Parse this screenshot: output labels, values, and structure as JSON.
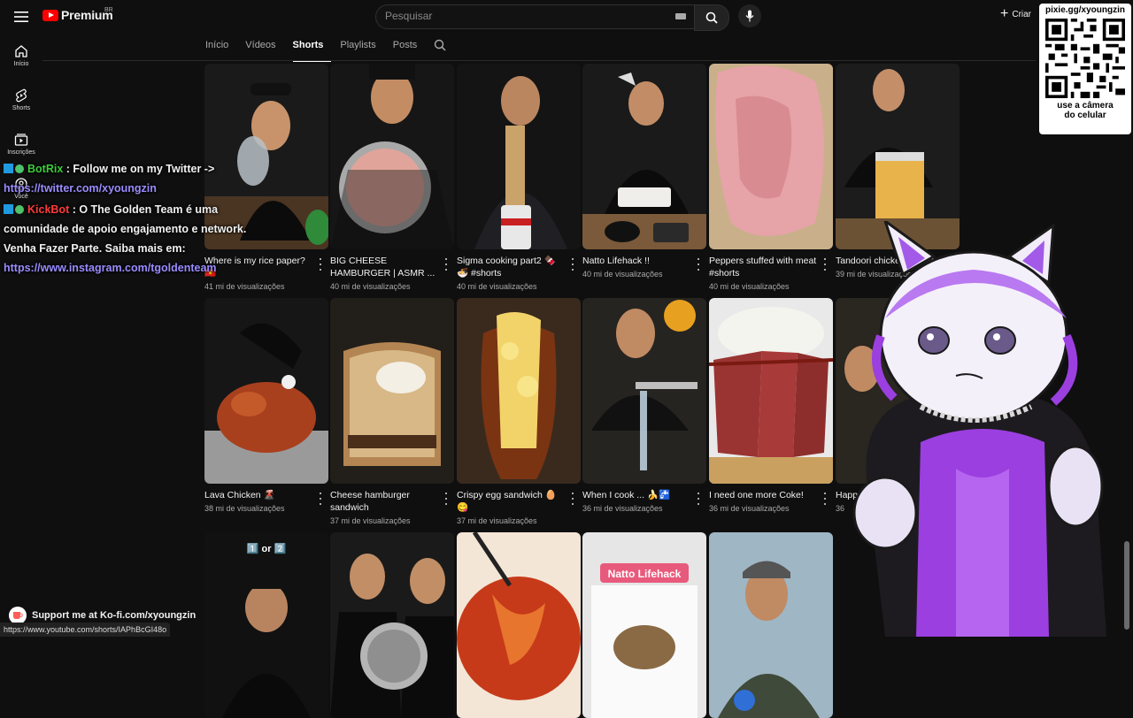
{
  "header": {
    "logo_text": "Premium",
    "logo_country": "BR",
    "search_placeholder": "Pesquisar",
    "create_label": "Criar"
  },
  "qr": {
    "title": "pixie.gg/xyoungzin",
    "caption_line1": "use a câmera",
    "caption_line2": "do celular"
  },
  "sidebar": {
    "items": [
      {
        "label": "Início",
        "icon": "home-icon"
      },
      {
        "label": "Shorts",
        "icon": "shorts-icon"
      },
      {
        "label": "Inscrições",
        "icon": "subscriptions-icon"
      },
      {
        "label": "Você",
        "icon": "you-icon"
      }
    ]
  },
  "tabs": [
    {
      "label": "Início"
    },
    {
      "label": "Vídeos"
    },
    {
      "label": "Shorts",
      "active": true
    },
    {
      "label": "Playlists"
    },
    {
      "label": "Posts"
    }
  ],
  "shorts": [
    {
      "title": "Where is my rice paper? 🇻🇳",
      "views": "41 mi de visualizações"
    },
    {
      "title": "BIG CHEESE HAMBURGER | ASMR ...",
      "views": "40 mi de visualizações"
    },
    {
      "title": "Sigma cooking part2 🍫🍜 #shorts",
      "views": "40 mi de visualizações"
    },
    {
      "title": "Natto Lifehack !!",
      "views": "40 mi de visualizações"
    },
    {
      "title": "Peppers stuffed with meat #shorts",
      "views": "40 mi de visualizações"
    },
    {
      "title": "Tandoori chicken #shorts",
      "views": "39 mi de visualizações"
    },
    {
      "title": "Lava Chicken 🌋",
      "views": "38 mi de visualizações"
    },
    {
      "title": "Cheese hamburger sandwich",
      "views": "37 mi de visualizações"
    },
    {
      "title": "Crispy egg sandwich 🥚😋",
      "views": "37 mi de visualizações"
    },
    {
      "title": "When I cook ... 🍌🚰",
      "views": "36 mi de visualizações"
    },
    {
      "title": "I need one more Coke!",
      "views": "36 mi de visualizações"
    },
    {
      "title": "Happ 😇",
      "views": "36"
    },
    {
      "title": "",
      "views": "",
      "thumb_text": "1️⃣ or 2️⃣"
    },
    {
      "title": "",
      "views": ""
    },
    {
      "title": "",
      "views": ""
    },
    {
      "title": "",
      "views": "",
      "thumb_text": "Natto Lifehack"
    },
    {
      "title": "",
      "views": ""
    }
  ],
  "chat": {
    "msg1_user": "BotRix",
    "msg1_text": " : Follow me on my Twitter ->",
    "msg1_link": "https://twitter.com/xyoungzin",
    "msg2_user": "KickBot",
    "msg2_text": " : O The Golden Team é uma comunidade de apoio engajamento e network. Venha Fazer Parte. Saiba mais em:",
    "msg2_link": "https://www.instagram.com/tgoldenteam"
  },
  "kofi": {
    "label": "Support me at Ko-fi.com/xyoungzin"
  },
  "status_url": "https://www.youtube.com/shorts/IAPhBcGI48o",
  "colors": {
    "accent": "#ff0000",
    "botrix": "#3ccd3c",
    "kickbot": "#ff3b3b",
    "link": "#9a8cff",
    "vtuber_purple": "#9b3fe0"
  }
}
